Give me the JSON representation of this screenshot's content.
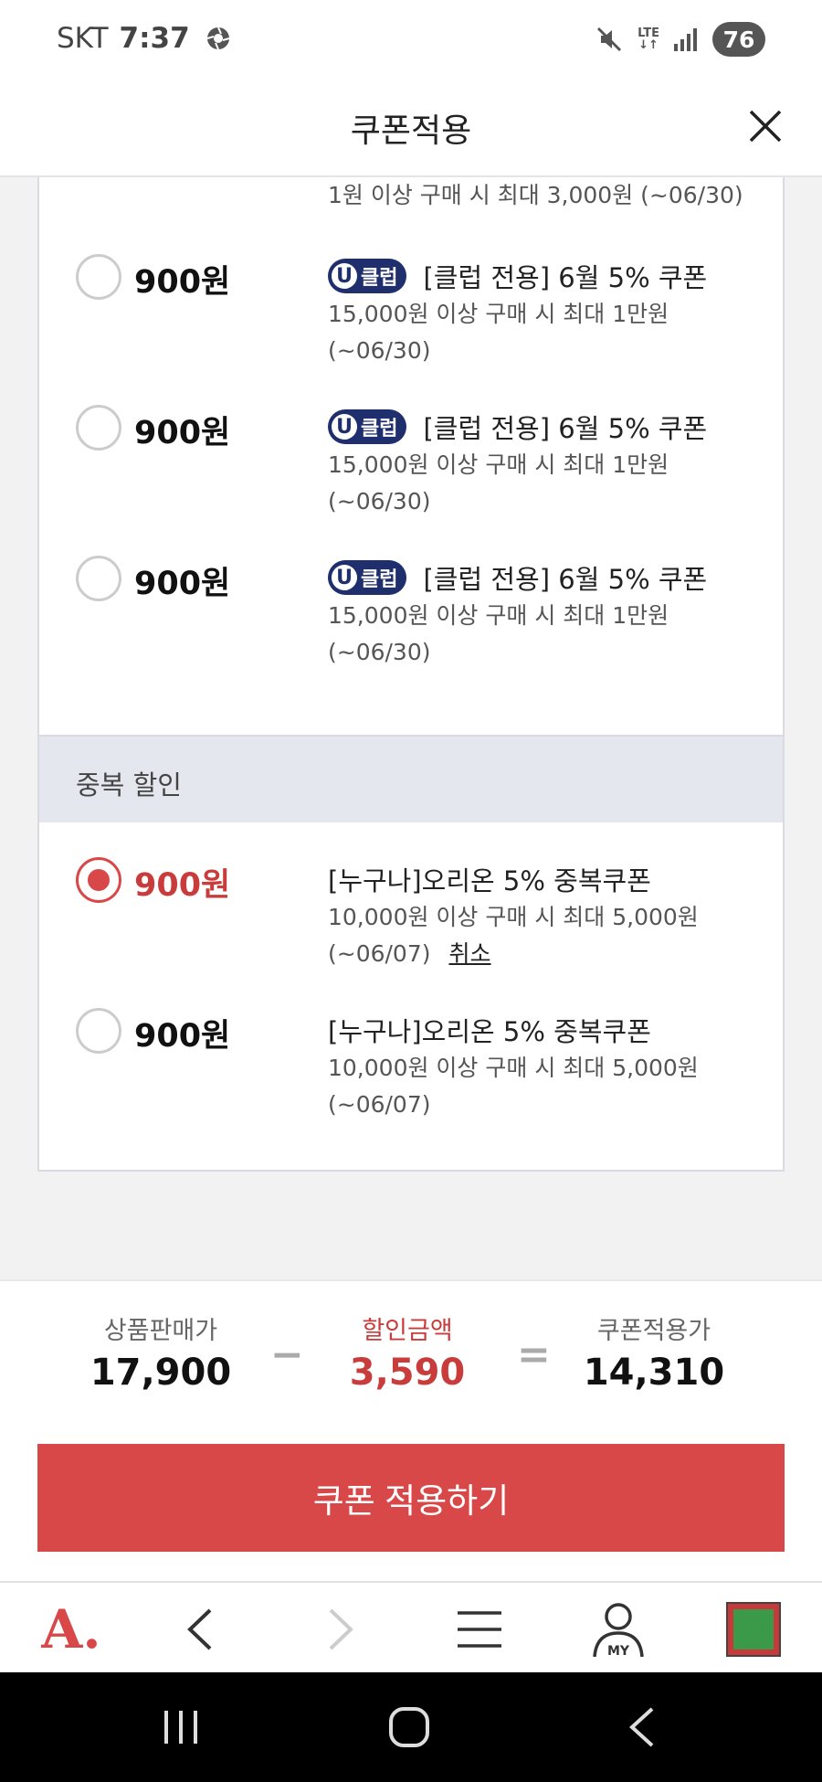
{
  "status_bar": {
    "carrier": "SKT",
    "time": "7:37",
    "network": [
      "LTE",
      "↓↑"
    ],
    "battery": "76"
  },
  "header": {
    "title": "쿠폰적용"
  },
  "top_partial_coupon": {
    "condition": "1원 이상 구매 시 최대 3,000원 (~06/30)"
  },
  "coupons": [
    {
      "amount": "900원",
      "badge": "U클럽",
      "badge_u": "U",
      "badge_text": "클럽",
      "title": "[클럽 전용] 6월 5% 쿠폰",
      "cond1": "15,000원 이상 구매 시 최대 1만원",
      "cond2": "(~06/30)"
    },
    {
      "amount": "900원",
      "badge": "U클럽",
      "badge_u": "U",
      "badge_text": "클럽",
      "title": "[클럽 전용] 6월 5% 쿠폰",
      "cond1": "15,000원 이상 구매 시 최대 1만원",
      "cond2": "(~06/30)"
    },
    {
      "amount": "900원",
      "badge": "U클럽",
      "badge_u": "U",
      "badge_text": "클럽",
      "title": "[클럽 전용] 6월 5% 쿠폰",
      "cond1": "15,000원 이상 구매 시 최대 1만원",
      "cond2": "(~06/30)"
    }
  ],
  "duplicate_section": {
    "label": "중복 할인",
    "coupons": [
      {
        "amount": "900원",
        "selected": true,
        "title": "[누구나]오리온 5% 중복쿠폰",
        "cond1": "10,000원 이상 구매 시 최대 5,000원",
        "cond2": "(~06/07)",
        "cancel": "취소"
      },
      {
        "amount": "900원",
        "selected": false,
        "title": "[누구나]오리온 5% 중복쿠폰",
        "cond1": "10,000원 이상 구매 시 최대 5,000원",
        "cond2": "(~06/07)"
      }
    ]
  },
  "summary": {
    "price_label": "상품판매가",
    "price": "17,900",
    "minus": "−",
    "discount_label": "할인금액",
    "discount": "3,590",
    "equals": "=",
    "final_label": "쿠폰적용가",
    "final": "14,310",
    "apply_button": "쿠폰 적용하기"
  },
  "bottom_nav": {
    "logo": "A.",
    "my_label": "MY"
  },
  "colors": {
    "accent": "#d94848",
    "badge": "#1f2f6e",
    "section_bg": "#e4e7ee"
  },
  "icons": [
    "mute-icon",
    "signal-icon",
    "close-icon",
    "back-icon",
    "forward-icon",
    "menu-icon",
    "my-icon",
    "recent-apps-icon",
    "home-icon",
    "android-back-icon"
  ]
}
